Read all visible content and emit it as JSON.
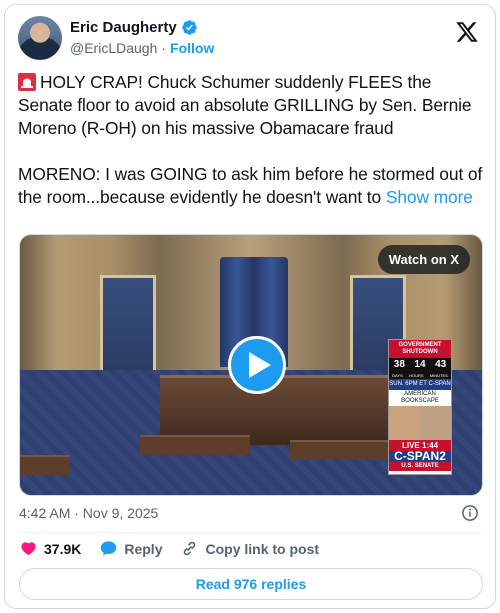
{
  "author": {
    "name": "Eric Daugherty",
    "handle": "@EricLDaugh",
    "separator": "·",
    "follow_label": "Follow"
  },
  "tweet": {
    "paragraph1": "HOLY CRAP! Chuck Schumer suddenly FLEES the Senate floor to avoid an absolute GRILLING by Sen. Bernie Moreno (R-OH) on his massive Obamacare fraud",
    "paragraph2": "MORENO: I was GOING to ask him before he stormed out of the room...because evidently he doesn't want to",
    "show_more_label": "Show more"
  },
  "video": {
    "watch_label": "Watch on X",
    "overlay": {
      "top_label_1": "GOVERNMENT",
      "top_label_2": "SHUTDOWN",
      "days": "38",
      "hours": "14",
      "minutes": "43",
      "days_label": "DAYS",
      "hours_label": "HOURS",
      "minutes_label": "MINUTES",
      "schedule": "SUN. 6PM ET C-SPAN",
      "program": "AMERICAN BOOKSCAPE",
      "live_label": "LIVE",
      "time": "1:44",
      "brand": "C-SPAN2",
      "sub": "U.S. SENATE"
    }
  },
  "footer": {
    "timestamp": "4:42 AM · Nov 9, 2025",
    "likes": "37.9K",
    "reply_label": "Reply",
    "copy_link_label": "Copy link to post",
    "read_replies_label": "Read 976 replies"
  },
  "colors": {
    "accent": "#1d9bf0",
    "like": "#f91880",
    "muted": "#536471"
  },
  "icons": [
    "verified-badge-icon",
    "x-logo-icon",
    "siren-icon",
    "play-icon",
    "info-icon",
    "heart-icon",
    "reply-icon",
    "link-icon"
  ]
}
